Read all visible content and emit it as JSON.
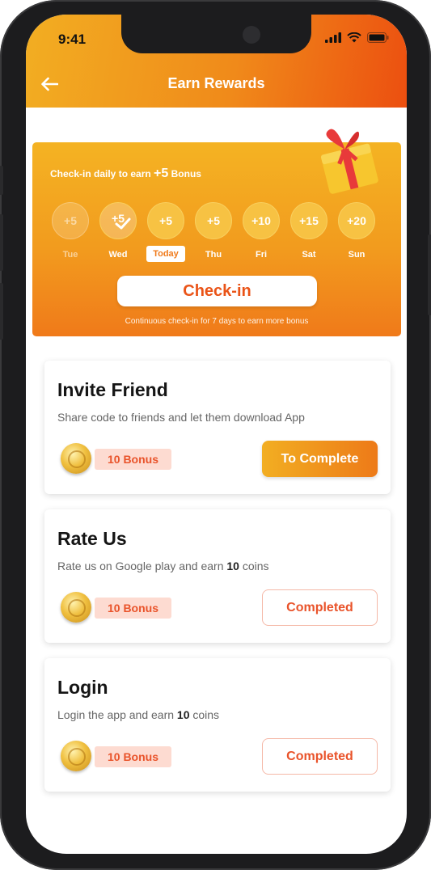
{
  "status_bar": {
    "time": "9:41"
  },
  "header": {
    "title": "Earn Rewards"
  },
  "checkin": {
    "title_prefix": "Check-in daily to earn",
    "bonus": "+5",
    "title_suffix": "Bonus",
    "days": [
      {
        "value": "+5",
        "label": "Tue",
        "state": "past"
      },
      {
        "value": "+5",
        "label": "Wed",
        "state": "checked"
      },
      {
        "value": "+5",
        "label": "Today",
        "state": "today"
      },
      {
        "value": "+5",
        "label": "Thu",
        "state": "upcoming"
      },
      {
        "value": "+10",
        "label": "Fri",
        "state": "upcoming"
      },
      {
        "value": "+15",
        "label": "Sat",
        "state": "upcoming"
      },
      {
        "value": "+20",
        "label": "Sun",
        "state": "upcoming"
      }
    ],
    "button_label": "Check-in",
    "note": "Continuous check-in for 7 days to earn more bonus"
  },
  "tasks": [
    {
      "title": "Invite Friend",
      "desc_text": "Share code to friends and let them download App",
      "bonus_label": "10 Bonus",
      "button_label": "To Complete",
      "status": "pending"
    },
    {
      "title": "Rate Us",
      "desc_before": "Rate us on Google play and earn ",
      "desc_bold": "10",
      "desc_after": " coins",
      "bonus_label": "10 Bonus",
      "button_label": "Completed",
      "status": "completed"
    },
    {
      "title": "Login",
      "desc_before": "Login the app and earn ",
      "desc_bold": "10",
      "desc_after": " coins",
      "bonus_label": "10 Bonus",
      "button_label": "Completed",
      "status": "completed"
    }
  ],
  "colors": {
    "primary_orange": "#f07a1a",
    "accent_red": "#e9532a",
    "badge_bg": "#fddbd1",
    "gold": "#f2ae22"
  },
  "icons": {
    "back": "arrow-left-icon",
    "signal": "signal-icon",
    "wifi": "wifi-icon",
    "battery": "battery-icon",
    "gift": "gift-icon",
    "coin": "coin-icon",
    "check": "check-icon"
  }
}
